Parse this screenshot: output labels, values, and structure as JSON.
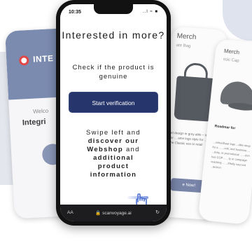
{
  "phone": {
    "status_time": "10:35",
    "status_icons": "..l ≈ ■",
    "title": "Interested in more?",
    "subtitle": "Check if the product is genuine",
    "verify_button": "Start verification",
    "swipe_intro": "Swipe left and",
    "swipe_bold_1": "discover our",
    "swipe_bold_2": "Webshop",
    "swipe_and": "and",
    "swipe_bold_3": "additional",
    "swipe_bold_4": "product",
    "swipe_bold_5": "information",
    "url_aa": "AA",
    "url": "🔒 scanvoyage.ai",
    "reload_icon": "↻"
  },
  "card_left": {
    "logo_text": "INTE",
    "welcome": "Welco",
    "integrity": "Integri"
  },
  "card_mid": {
    "title": "Merch",
    "subtitle": "ate Bag",
    "description": "let design in grey able – ideal for ... ame logo style for ... with the Classic ess or retail",
    "cta": "e Now!"
  },
  "card_right": {
    "title": "Merch",
    "subtitle": "ssic Cap",
    "item_title": "Roadmar for",
    "description": "...unheidbaar logo ...dike strap for a ... ...ook, and business ... ...tivity, or promotional ... ...tion has COP ... ...ly or campaign reaching ... ...thfully sourced ...tection"
  },
  "colors": {
    "accent": "#26356b",
    "card_blue": "#7b8bb0",
    "hand": "#4d70d2"
  }
}
